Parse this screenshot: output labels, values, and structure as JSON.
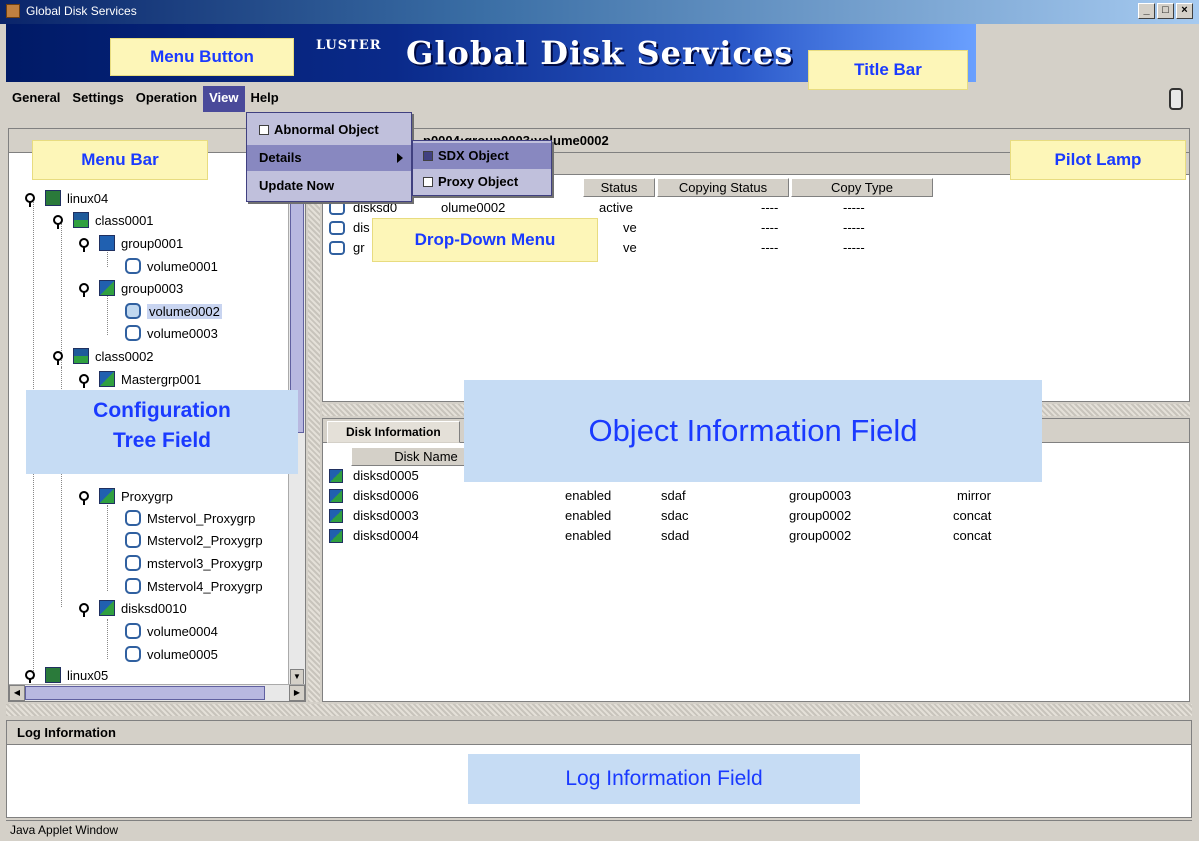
{
  "window": {
    "title": "Global Disk Services",
    "controls": [
      "_",
      "□",
      "×"
    ]
  },
  "banner": {
    "cluster_text": "LUSTER",
    "title": "Global Disk Services"
  },
  "menu": {
    "items": [
      "General",
      "Settings",
      "Operation",
      "View",
      "Help"
    ],
    "active": "View"
  },
  "dropdown": {
    "items": [
      {
        "label": "Abnormal Object",
        "checkbox": true,
        "checked": false
      },
      {
        "label": "Details",
        "submenu": true
      },
      {
        "label": "Update Now"
      }
    ],
    "submenu": [
      {
        "label": "SDX Object",
        "checked": true
      },
      {
        "label": "Proxy Object",
        "checked": false
      }
    ]
  },
  "tree": {
    "nodes": [
      {
        "label": "linux04",
        "type": "node"
      },
      {
        "label": "class0001",
        "type": "class"
      },
      {
        "label": "group0001",
        "type": "group"
      },
      {
        "label": "volume0001",
        "type": "volume"
      },
      {
        "label": "group0003",
        "type": "group"
      },
      {
        "label": "volume0002",
        "type": "volume",
        "selected": true
      },
      {
        "label": "volume0003",
        "type": "volume"
      },
      {
        "label": "class0002",
        "type": "class"
      },
      {
        "label": "Mastergrp001",
        "type": "group"
      },
      {
        "label": "Proxygrp",
        "type": "group"
      },
      {
        "label": "Mstervol_Proxygrp",
        "type": "volume"
      },
      {
        "label": "Mstervol2_Proxygrp",
        "type": "volume"
      },
      {
        "label": "mstervol3_Proxygrp",
        "type": "volume"
      },
      {
        "label": "Mstervol4_Proxygrp",
        "type": "volume"
      },
      {
        "label": "disksd0010",
        "type": "group"
      },
      {
        "label": "volume0004",
        "type": "volume"
      },
      {
        "label": "volume0005",
        "type": "volume"
      },
      {
        "label": "linux05",
        "type": "node"
      }
    ]
  },
  "object_info": {
    "path_title": "p0004:group0003:volume0002",
    "columns": [
      "Status",
      "Copying Status",
      "Copy Type"
    ],
    "rows": [
      {
        "name": "disksd0",
        "name2": "olume0002",
        "status": "active",
        "copying": "----",
        "copytype": "-----"
      },
      {
        "name": "dis",
        "status": "ve",
        "copying": "----",
        "copytype": "-----"
      },
      {
        "name": "gr",
        "status": "ve",
        "copying": "----",
        "copytype": "-----"
      }
    ]
  },
  "disk_info": {
    "tab": "Disk Information",
    "column": "Disk Name",
    "rows": [
      {
        "name": "disksd0005",
        "status": "",
        "device": "",
        "group": "",
        "type": ""
      },
      {
        "name": "disksd0006",
        "status": "enabled",
        "device": "sdaf",
        "group": "group0003",
        "type": "mirror"
      },
      {
        "name": "disksd0003",
        "status": "enabled",
        "device": "sdac",
        "group": "group0002",
        "type": "concat"
      },
      {
        "name": "disksd0004",
        "status": "enabled",
        "device": "sdad",
        "group": "group0002",
        "type": "concat"
      }
    ]
  },
  "log": {
    "title": "Log Information"
  },
  "status_bar": {
    "text": "Java Applet Window"
  },
  "callouts": {
    "menu_button": "Menu Button",
    "title_bar": "Title Bar",
    "menu_bar": "Menu Bar",
    "pilot_lamp": "Pilot Lamp",
    "drop_down": "Drop-Down Menu",
    "config_tree_1": "Configuration",
    "config_tree_2": "Tree Field",
    "object_info": "Object Information Field",
    "log_info": "Log Information Field"
  }
}
